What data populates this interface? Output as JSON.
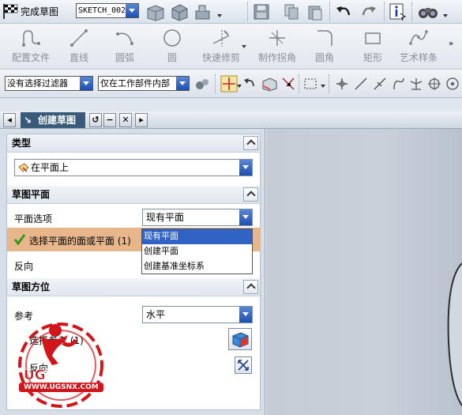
{
  "toolbar1": {
    "finish_label": "完成草图",
    "sketch_name": "SKETCH_002"
  },
  "toolbar2": {
    "tools": [
      {
        "label": "配置文件",
        "icon": "profile-icon"
      },
      {
        "label": "直线",
        "icon": "line-icon"
      },
      {
        "label": "圆弧",
        "icon": "arc-icon"
      },
      {
        "label": "圆",
        "icon": "circle-icon"
      },
      {
        "label": "快速修剪",
        "icon": "quick-trim-icon"
      },
      {
        "label": "制作拐角",
        "icon": "make-corner-icon"
      },
      {
        "label": "圆角",
        "icon": "fillet-icon"
      },
      {
        "label": "矩形",
        "icon": "rectangle-icon"
      },
      {
        "label": "艺术样条",
        "icon": "studio-spline-icon"
      }
    ]
  },
  "toolbar3": {
    "filter": "没有选择过滤器",
    "scope": "仅在工作部件内部"
  },
  "dialog": {
    "title": "创建草图",
    "sections": {
      "type": {
        "header": "类型",
        "value": "在平面上"
      },
      "plane": {
        "header": "草图平面",
        "option_label": "平面选项",
        "option_value": "现有平面",
        "select_label": "选择平面的面或平面 (1)",
        "reverse_label": "反向",
        "options": [
          "现有平面",
          "创建平面",
          "创建基准坐标系"
        ]
      },
      "orientation": {
        "header": "草图方位",
        "ref_label": "参考",
        "ref_value": "水平",
        "select_label": "选择参考 (1)",
        "reverse_label": "反向"
      }
    }
  },
  "watermark": {
    "brand": "UG爱好者",
    "url": "WWW.UGSNX.COM"
  },
  "colors": {
    "accent": "#3163c5",
    "selection_row": "#e7b68b",
    "watermark_red": "#d0161b"
  }
}
